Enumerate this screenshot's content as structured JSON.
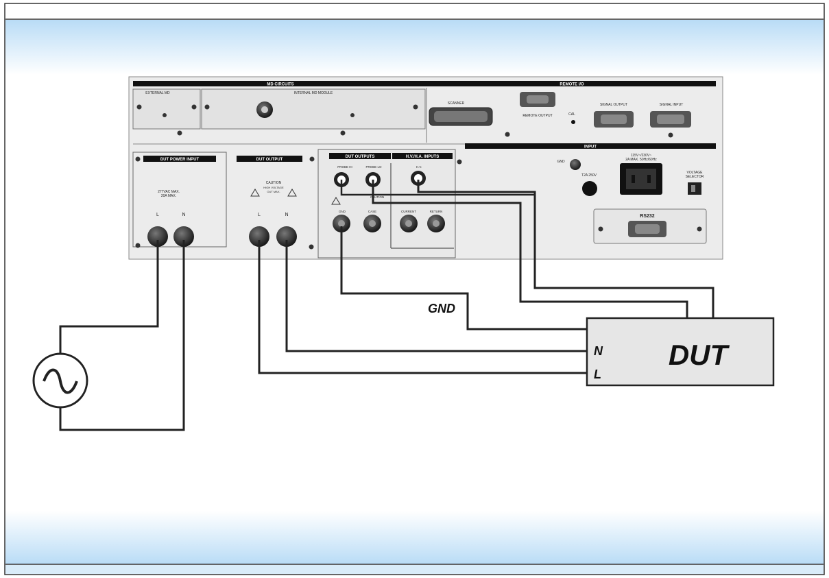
{
  "panel": {
    "md_circuits": "MD CIRCUITS",
    "remote_io": "REMOTE I/O",
    "external_md": "EXTERNAL MD",
    "internal_md_module": "INTERNAL MD MODULE",
    "scanner": "SCANNER",
    "remote_output": "REMOTE OUTPUT",
    "cal": "CAL",
    "signal_output": "SIGNAL OUTPUT",
    "signal_input": "SIGNAL INPUT",
    "input": "INPUT",
    "gnd_small": "GND",
    "power_rating_1": "115V~/230V~",
    "power_rating_2": "2A MAX. 50Hz/60Hz",
    "fuse": "T2A 250V",
    "voltage_selector_1": "VOLTAGE",
    "voltage_selector_2": "SELECTOR",
    "rs232": "RS232",
    "dut_power_input": "DUT POWER INPUT",
    "dut_power_rating_1": "277VAC MAX.",
    "dut_power_rating_2": "20A MAX.",
    "dut_output": "DUT OUTPUT",
    "caution": "CAUTION",
    "caution_sub_1": "HIGH VOLTAGE",
    "caution_sub_2": "OUT MAX.",
    "dut_outputs": "DUT OUTPUTS",
    "hv_ha_inputs": "H.V./H.A. INPUTS",
    "probe_hi": "PROBE HI",
    "probe_lo": "PROBE LO",
    "hv": "H.V.",
    "gnd_post": "GND",
    "case": "CASE",
    "current": "CURRENT",
    "return": "RETURN",
    "L": "L",
    "N": "N"
  },
  "diagram": {
    "gnd_label": "GND",
    "dut_label": "DUT",
    "dut_n": "N",
    "dut_l": "L",
    "source_symbol": "∿"
  },
  "colors": {
    "gradient_top": "#b9dcf6",
    "panel_bg": "#ececec",
    "wire": "#222222",
    "dut_box": "#e6e6e6"
  }
}
